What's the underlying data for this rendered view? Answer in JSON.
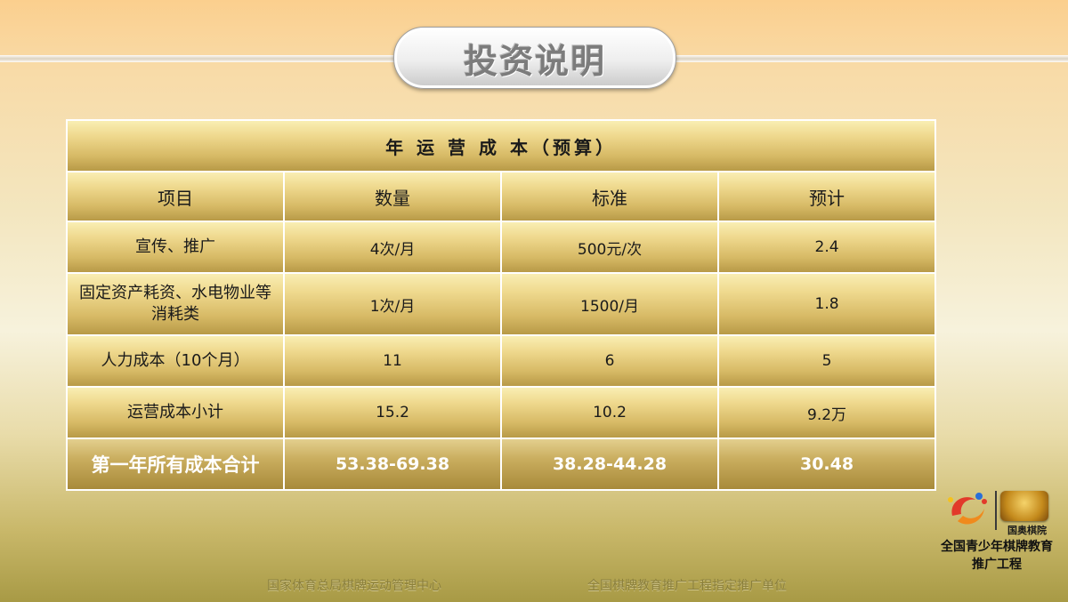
{
  "slide": {
    "title": "投资说明"
  },
  "table": {
    "caption": "年 运 营 成 本（预算）",
    "headers": [
      "项目",
      "数量",
      "标准",
      "预计"
    ],
    "rows": [
      [
        "宣传、推广",
        "4次/月",
        "500元/次",
        "2.4"
      ],
      [
        "固定资产耗资、水电物业等消耗类",
        "1次/月",
        "1500/月",
        "1.8"
      ],
      [
        "人力成本（10个月）",
        "11",
        "6",
        "5"
      ],
      [
        "运营成本小计",
        "15.2",
        "10.2",
        "9.2万"
      ]
    ],
    "total": [
      "第一年所有成本合计",
      "53.38-69.38",
      "38.28-44.28",
      "30.48"
    ]
  },
  "footer": {
    "left": "国家体育总局棋牌运动管理中心",
    "right": "全国棋牌教育推广工程指定推广单位"
  },
  "logo": {
    "brand": "国奥棋院",
    "line1": "全国青少年棋牌教育",
    "line2": "推广工程"
  },
  "colors": {
    "accent": "#d7ba66",
    "total_text": "#ffffff",
    "title_text": "#7c7c7c"
  }
}
